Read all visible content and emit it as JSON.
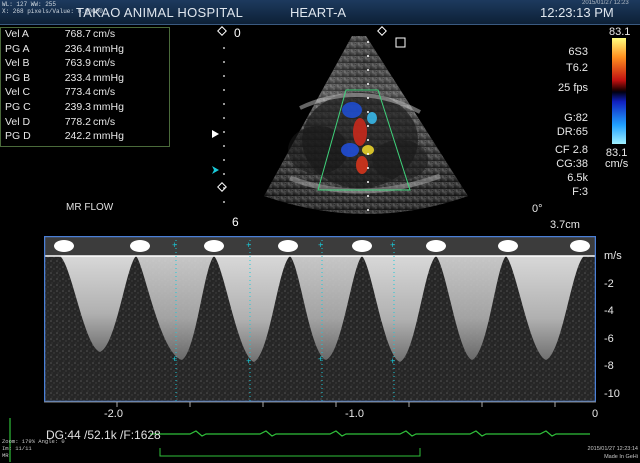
{
  "header": {
    "tiny_line1": "WL: 127 WW: 255",
    "tiny_line2": "X: 268 pixels/Value: 0.00000",
    "hospital": "TAKAO ANIMAL HOSPITAL",
    "mode": "HEART-A",
    "time": "12:23:13 PM",
    "date_small": "2015/01/27 12:23"
  },
  "measurements": [
    {
      "label": "Vel  A",
      "value": "768.7",
      "unit": "cm/s"
    },
    {
      "label": "PG  A",
      "value": "236.4",
      "unit": "mmHg"
    },
    {
      "label": "Vel  B",
      "value": "763.9",
      "unit": "cm/s"
    },
    {
      "label": "PG  B",
      "value": "233.4",
      "unit": "mmHg"
    },
    {
      "label": "Vel  C",
      "value": "773.4",
      "unit": "cm/s"
    },
    {
      "label": "PG  C",
      "value": "239.3",
      "unit": "mmHg"
    },
    {
      "label": "Vel  D",
      "value": "778.2",
      "unit": "cm/s"
    },
    {
      "label": "PG  D",
      "value": "242.2",
      "unit": "mmHg"
    }
  ],
  "sector": {
    "depth_top": "0",
    "depth_bottom": "6",
    "label": "MR FLOW",
    "angle": "0°",
    "depth": "3.7cm"
  },
  "params": {
    "probe": "6S3",
    "preset": "T6.2",
    "fps": "25 fps",
    "gain": "G:82",
    "dr": "DR:65",
    "cf": "CF 2.8",
    "cg": "CG:38",
    "prf": "6.5k",
    "filter": "F:3"
  },
  "colorbar": {
    "top": "83.1",
    "bottom": "83.1",
    "unit": "cm/s"
  },
  "doppler": {
    "unit": "m/s",
    "y_ticks": [
      "-2",
      "-4",
      "-6",
      "-8",
      "-10"
    ],
    "x_ticks": [
      "-2.0",
      "-1.0",
      "0"
    ],
    "footer": "DG:44  /52.1k  /F:1628"
  },
  "footer": {
    "left1": "Zoom: 179% Angle: 0",
    "left2": "Im: 11/11",
    "left3": "MR",
    "right1": "2015/01/27 12:23:14",
    "right2": "Made In GeHi"
  },
  "colors": {
    "header_bg": "#1d3a5e",
    "cyan_marker": "#19c9d8",
    "doppler_border": "#4a7fd6",
    "ecg_green": "#2fbf3a"
  }
}
